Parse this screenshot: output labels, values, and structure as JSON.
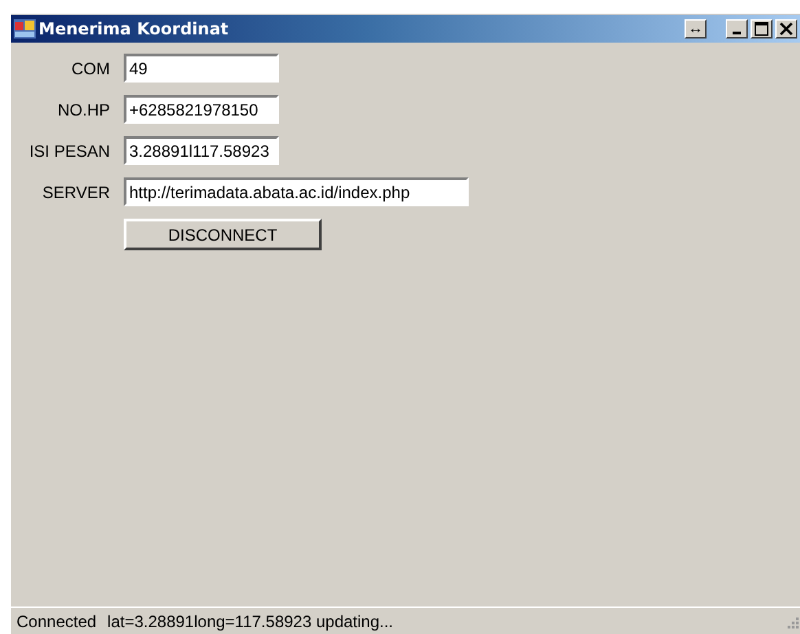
{
  "window": {
    "title": "Menerima Koordinat",
    "buttons": [
      "↔"
    ]
  },
  "fields": [
    {
      "label": "COM",
      "value": "49"
    },
    {
      "label": "NO.HP",
      "value": "+6285821978150"
    },
    {
      "label": "ISI PESAN",
      "value": "3.28891l117.58923"
    },
    {
      "label": "SERVER",
      "value": "http://terimadata.abata.ac.id/index.php"
    }
  ],
  "button": {
    "label": "DISCONNECT"
  },
  "status_bar": [
    "Connected",
    "lat=3.28891long=117.58923 updating..."
  ]
}
